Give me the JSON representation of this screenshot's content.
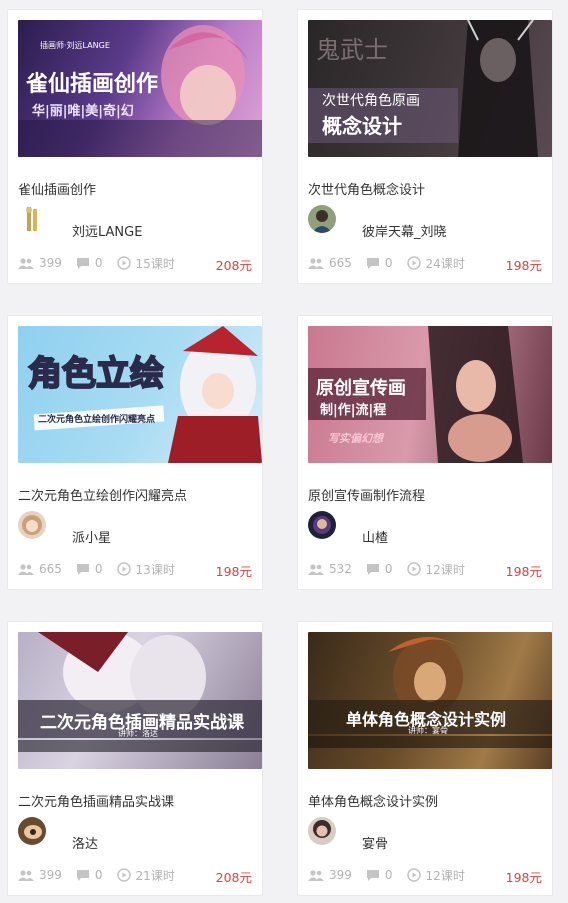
{
  "courses": [
    {
      "thumb_main": "雀仙插画创作",
      "thumb_sub": "华|丽|唯|美|奇|幻",
      "thumb_tag": "插画师·刘远LANGE",
      "title": "雀仙插画创作",
      "author": "刘远LANGE",
      "students": "399",
      "comments": "0",
      "lessons": "15课时",
      "price": "208元"
    },
    {
      "thumb_main": "概念设计",
      "thumb_sub": "次世代角色原画",
      "thumb_tag": "鬼武士",
      "title": "次世代角色概念设计",
      "author": "彼岸天幕_刘晓",
      "students": "665",
      "comments": "0",
      "lessons": "24课时",
      "price": "198元"
    },
    {
      "thumb_main": "角色立绘",
      "thumb_sub": "二次元角色立绘创作闪耀亮点",
      "thumb_tag": "",
      "title": "二次元角色立绘创作闪耀亮点",
      "author": "派小星",
      "students": "665",
      "comments": "0",
      "lessons": "13课时",
      "price": "198元"
    },
    {
      "thumb_main": "原创宣传画",
      "thumb_sub": "制|作|流|程",
      "thumb_tag": "写实偏幻想",
      "title": "原创宣传画制作流程",
      "author": "山楂",
      "students": "532",
      "comments": "0",
      "lessons": "12课时",
      "price": "198元"
    },
    {
      "thumb_main": "二次元角色插画精品实战课",
      "thumb_sub": "讲师：洛达",
      "thumb_tag": "",
      "title": "二次元角色插画精品实战课",
      "author": "洛达",
      "students": "399",
      "comments": "0",
      "lessons": "21课时",
      "price": "208元"
    },
    {
      "thumb_main": "单体角色概念设计实例",
      "thumb_sub": "讲师：宴骨",
      "thumb_tag": "",
      "title": "单体角色概念设计实例",
      "author": "宴骨",
      "students": "399",
      "comments": "0",
      "lessons": "12课时",
      "price": "198元"
    }
  ],
  "colors": {
    "price": "#e0413c",
    "meta": "#b3b3b3",
    "title": "#333333"
  }
}
